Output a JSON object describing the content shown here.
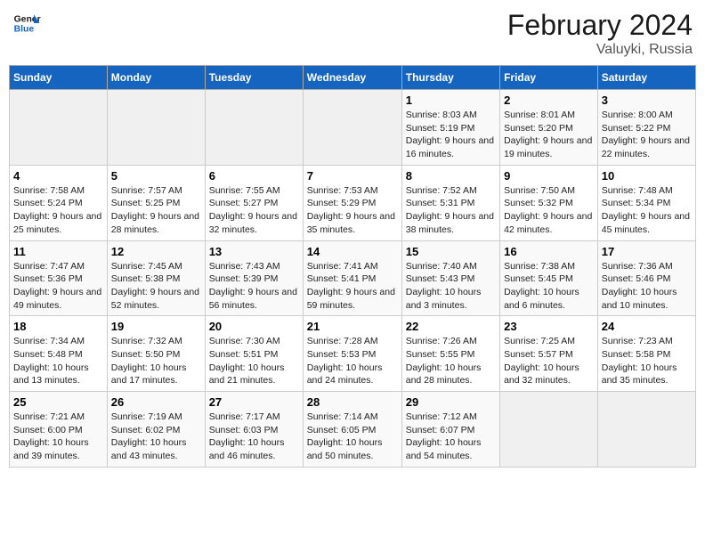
{
  "header": {
    "logo_general": "General",
    "logo_blue": "Blue",
    "month_title": "February 2024",
    "location": "Valuyki, Russia"
  },
  "weekdays": [
    "Sunday",
    "Monday",
    "Tuesday",
    "Wednesday",
    "Thursday",
    "Friday",
    "Saturday"
  ],
  "weeks": [
    [
      {
        "day": "",
        "sunrise": "",
        "sunset": "",
        "daylight": ""
      },
      {
        "day": "",
        "sunrise": "",
        "sunset": "",
        "daylight": ""
      },
      {
        "day": "",
        "sunrise": "",
        "sunset": "",
        "daylight": ""
      },
      {
        "day": "",
        "sunrise": "",
        "sunset": "",
        "daylight": ""
      },
      {
        "day": "1",
        "sunrise": "Sunrise: 8:03 AM",
        "sunset": "Sunset: 5:19 PM",
        "daylight": "Daylight: 9 hours and 16 minutes."
      },
      {
        "day": "2",
        "sunrise": "Sunrise: 8:01 AM",
        "sunset": "Sunset: 5:20 PM",
        "daylight": "Daylight: 9 hours and 19 minutes."
      },
      {
        "day": "3",
        "sunrise": "Sunrise: 8:00 AM",
        "sunset": "Sunset: 5:22 PM",
        "daylight": "Daylight: 9 hours and 22 minutes."
      }
    ],
    [
      {
        "day": "4",
        "sunrise": "Sunrise: 7:58 AM",
        "sunset": "Sunset: 5:24 PM",
        "daylight": "Daylight: 9 hours and 25 minutes."
      },
      {
        "day": "5",
        "sunrise": "Sunrise: 7:57 AM",
        "sunset": "Sunset: 5:25 PM",
        "daylight": "Daylight: 9 hours and 28 minutes."
      },
      {
        "day": "6",
        "sunrise": "Sunrise: 7:55 AM",
        "sunset": "Sunset: 5:27 PM",
        "daylight": "Daylight: 9 hours and 32 minutes."
      },
      {
        "day": "7",
        "sunrise": "Sunrise: 7:53 AM",
        "sunset": "Sunset: 5:29 PM",
        "daylight": "Daylight: 9 hours and 35 minutes."
      },
      {
        "day": "8",
        "sunrise": "Sunrise: 7:52 AM",
        "sunset": "Sunset: 5:31 PM",
        "daylight": "Daylight: 9 hours and 38 minutes."
      },
      {
        "day": "9",
        "sunrise": "Sunrise: 7:50 AM",
        "sunset": "Sunset: 5:32 PM",
        "daylight": "Daylight: 9 hours and 42 minutes."
      },
      {
        "day": "10",
        "sunrise": "Sunrise: 7:48 AM",
        "sunset": "Sunset: 5:34 PM",
        "daylight": "Daylight: 9 hours and 45 minutes."
      }
    ],
    [
      {
        "day": "11",
        "sunrise": "Sunrise: 7:47 AM",
        "sunset": "Sunset: 5:36 PM",
        "daylight": "Daylight: 9 hours and 49 minutes."
      },
      {
        "day": "12",
        "sunrise": "Sunrise: 7:45 AM",
        "sunset": "Sunset: 5:38 PM",
        "daylight": "Daylight: 9 hours and 52 minutes."
      },
      {
        "day": "13",
        "sunrise": "Sunrise: 7:43 AM",
        "sunset": "Sunset: 5:39 PM",
        "daylight": "Daylight: 9 hours and 56 minutes."
      },
      {
        "day": "14",
        "sunrise": "Sunrise: 7:41 AM",
        "sunset": "Sunset: 5:41 PM",
        "daylight": "Daylight: 9 hours and 59 minutes."
      },
      {
        "day": "15",
        "sunrise": "Sunrise: 7:40 AM",
        "sunset": "Sunset: 5:43 PM",
        "daylight": "Daylight: 10 hours and 3 minutes."
      },
      {
        "day": "16",
        "sunrise": "Sunrise: 7:38 AM",
        "sunset": "Sunset: 5:45 PM",
        "daylight": "Daylight: 10 hours and 6 minutes."
      },
      {
        "day": "17",
        "sunrise": "Sunrise: 7:36 AM",
        "sunset": "Sunset: 5:46 PM",
        "daylight": "Daylight: 10 hours and 10 minutes."
      }
    ],
    [
      {
        "day": "18",
        "sunrise": "Sunrise: 7:34 AM",
        "sunset": "Sunset: 5:48 PM",
        "daylight": "Daylight: 10 hours and 13 minutes."
      },
      {
        "day": "19",
        "sunrise": "Sunrise: 7:32 AM",
        "sunset": "Sunset: 5:50 PM",
        "daylight": "Daylight: 10 hours and 17 minutes."
      },
      {
        "day": "20",
        "sunrise": "Sunrise: 7:30 AM",
        "sunset": "Sunset: 5:51 PM",
        "daylight": "Daylight: 10 hours and 21 minutes."
      },
      {
        "day": "21",
        "sunrise": "Sunrise: 7:28 AM",
        "sunset": "Sunset: 5:53 PM",
        "daylight": "Daylight: 10 hours and 24 minutes."
      },
      {
        "day": "22",
        "sunrise": "Sunrise: 7:26 AM",
        "sunset": "Sunset: 5:55 PM",
        "daylight": "Daylight: 10 hours and 28 minutes."
      },
      {
        "day": "23",
        "sunrise": "Sunrise: 7:25 AM",
        "sunset": "Sunset: 5:57 PM",
        "daylight": "Daylight: 10 hours and 32 minutes."
      },
      {
        "day": "24",
        "sunrise": "Sunrise: 7:23 AM",
        "sunset": "Sunset: 5:58 PM",
        "daylight": "Daylight: 10 hours and 35 minutes."
      }
    ],
    [
      {
        "day": "25",
        "sunrise": "Sunrise: 7:21 AM",
        "sunset": "Sunset: 6:00 PM",
        "daylight": "Daylight: 10 hours and 39 minutes."
      },
      {
        "day": "26",
        "sunrise": "Sunrise: 7:19 AM",
        "sunset": "Sunset: 6:02 PM",
        "daylight": "Daylight: 10 hours and 43 minutes."
      },
      {
        "day": "27",
        "sunrise": "Sunrise: 7:17 AM",
        "sunset": "Sunset: 6:03 PM",
        "daylight": "Daylight: 10 hours and 46 minutes."
      },
      {
        "day": "28",
        "sunrise": "Sunrise: 7:14 AM",
        "sunset": "Sunset: 6:05 PM",
        "daylight": "Daylight: 10 hours and 50 minutes."
      },
      {
        "day": "29",
        "sunrise": "Sunrise: 7:12 AM",
        "sunset": "Sunset: 6:07 PM",
        "daylight": "Daylight: 10 hours and 54 minutes."
      },
      {
        "day": "",
        "sunrise": "",
        "sunset": "",
        "daylight": ""
      },
      {
        "day": "",
        "sunrise": "",
        "sunset": "",
        "daylight": ""
      }
    ]
  ]
}
